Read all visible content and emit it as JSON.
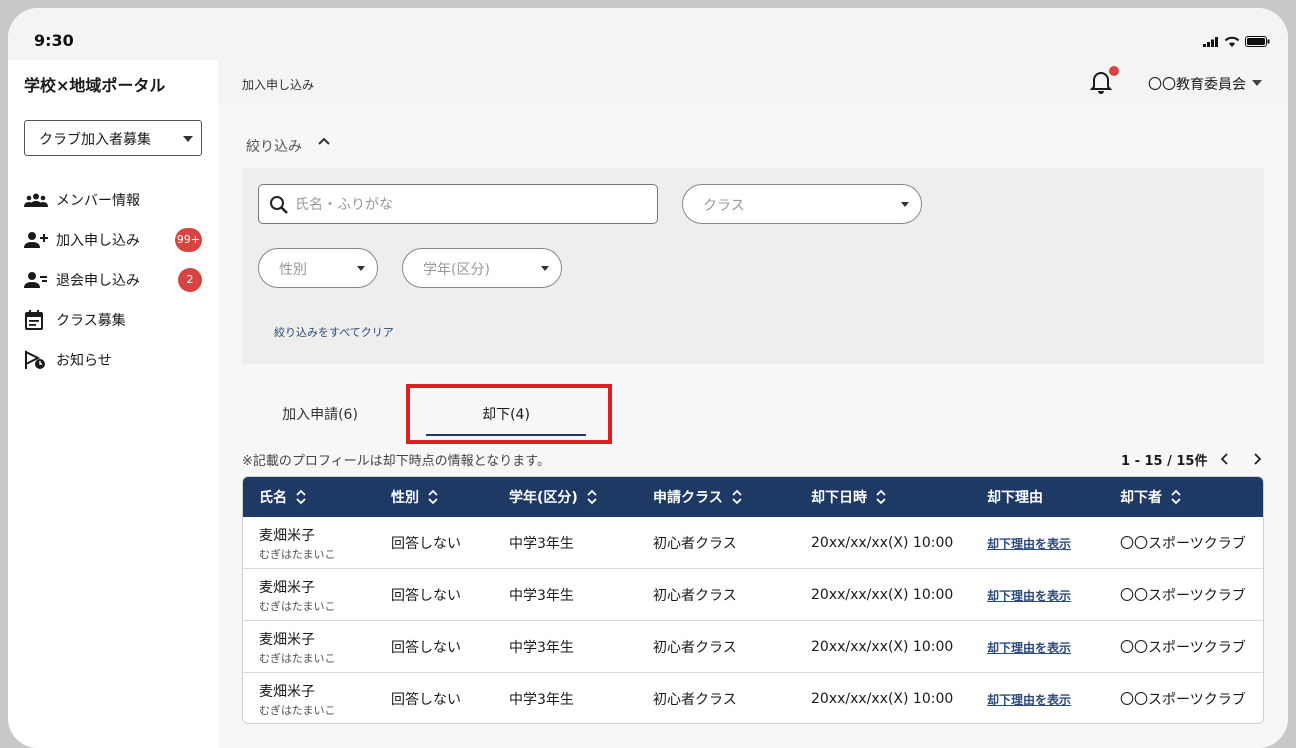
{
  "status_bar": {
    "time": "9:30"
  },
  "app": {
    "title": "学校×地域ポータル"
  },
  "sidebar": {
    "club_select": "クラブ加入者募集",
    "items": [
      {
        "label": "メンバー情報",
        "icon": "group-icon",
        "badge": ""
      },
      {
        "label": "加入申し込み",
        "icon": "person-add-icon",
        "badge": "99+"
      },
      {
        "label": "退会申し込み",
        "icon": "person-remove-icon",
        "badge": "2"
      },
      {
        "label": "クラス募集",
        "icon": "calendar-icon",
        "badge": ""
      },
      {
        "label": "お知らせ",
        "icon": "announcement-icon",
        "badge": ""
      }
    ]
  },
  "header": {
    "breadcrumb": "加入申し込み",
    "org": "〇〇教育委員会"
  },
  "filter": {
    "heading": "絞り込み",
    "search_placeholder": "氏名・ふりがな",
    "class_placeholder": "クラス",
    "gender_placeholder": "性別",
    "grade_placeholder": "学年(区分)",
    "clear_label": "絞り込みをすべてクリア"
  },
  "tabs": [
    {
      "label": "加入申請(6)",
      "active": false
    },
    {
      "label": "却下(4)",
      "active": true
    }
  ],
  "note": "※記載のプロフィールは却下時点の情報となります。",
  "pagination": {
    "text": "1 - 15 / 15件"
  },
  "table": {
    "headers": [
      "氏名",
      "性別",
      "学年(区分)",
      "申請クラス",
      "却下日時",
      "却下理由",
      "却下者"
    ],
    "rows": [
      {
        "name": "麦畑米子",
        "kana": "むぎはたまいこ",
        "gender": "回答しない",
        "grade": "中学3年生",
        "class": "初心者クラス",
        "date": "20xx/xx/xx(X) 10:00",
        "reason_link": "却下理由を表示",
        "rejected_by": "〇〇スポーツクラブ"
      },
      {
        "name": "麦畑米子",
        "kana": "むぎはたまいこ",
        "gender": "回答しない",
        "grade": "中学3年生",
        "class": "初心者クラス",
        "date": "20xx/xx/xx(X) 10:00",
        "reason_link": "却下理由を表示",
        "rejected_by": "〇〇スポーツクラブ"
      },
      {
        "name": "麦畑米子",
        "kana": "むぎはたまいこ",
        "gender": "回答しない",
        "grade": "中学3年生",
        "class": "初心者クラス",
        "date": "20xx/xx/xx(X) 10:00",
        "reason_link": "却下理由を表示",
        "rejected_by": "〇〇スポーツクラブ"
      },
      {
        "name": "麦畑米子",
        "kana": "むぎはたまいこ",
        "gender": "回答しない",
        "grade": "中学3年生",
        "class": "初心者クラス",
        "date": "20xx/xx/xx(X) 10:00",
        "reason_link": "却下理由を表示",
        "rejected_by": "〇〇スポーツクラブ"
      }
    ]
  },
  "colors": {
    "header_navy": "#1e3a64",
    "badge_red": "#d64541",
    "highlight_red": "#e02020",
    "link_blue": "#2c4a7a"
  }
}
